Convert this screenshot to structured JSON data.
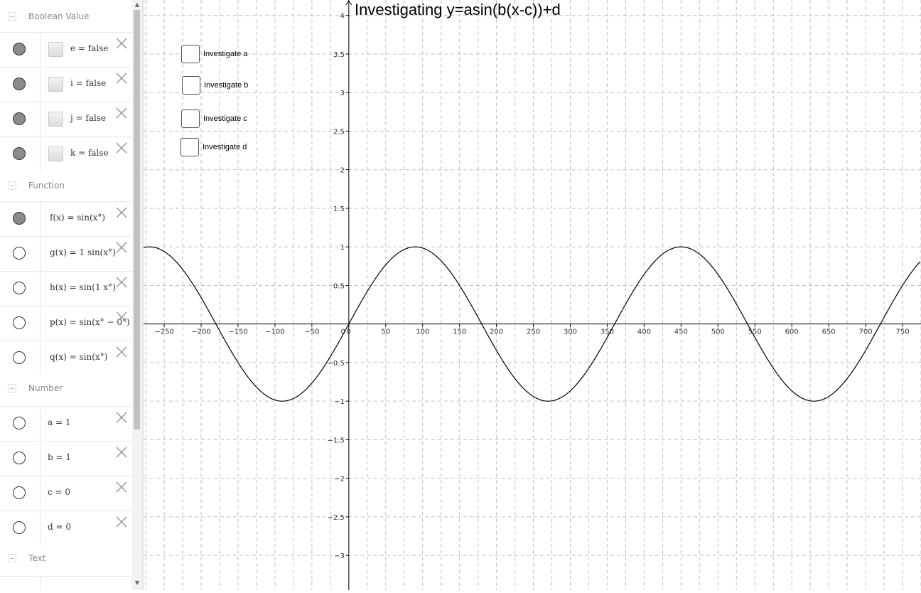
{
  "algebra": {
    "categories": [
      {
        "label": "Boolean Value"
      },
      {
        "label": "Function"
      },
      {
        "label": "Number"
      },
      {
        "label": "Text"
      }
    ],
    "boolean_rows": [
      {
        "text": "e = false",
        "visible": true
      },
      {
        "text": "i = false",
        "visible": true
      },
      {
        "text": "j = false",
        "visible": true
      },
      {
        "text": "k = false",
        "visible": true
      }
    ],
    "function_rows": [
      {
        "text": "f(x) = sin(x°)",
        "visible": true
      },
      {
        "text": "g(x) = 1 sin(x°)",
        "visible": false
      },
      {
        "text": "h(x) = sin(1 x°)",
        "visible": false
      },
      {
        "text": "p(x) = sin(x° − 0°)",
        "visible": false
      },
      {
        "text": "q(x) = sin(x°)",
        "visible": false
      }
    ],
    "number_rows": [
      {
        "text": "a = 1",
        "visible": false
      },
      {
        "text": "b = 1",
        "visible": false
      },
      {
        "text": "c = 0",
        "visible": false
      },
      {
        "text": "d = 0",
        "visible": false
      }
    ]
  },
  "graphics": {
    "title": "Investigating y=asin(b(x-c))+d",
    "checkboxes": [
      {
        "label": "Investigate a",
        "checked": false
      },
      {
        "label": "Investigate b",
        "checked": false
      },
      {
        "label": "Investigate c",
        "checked": false
      },
      {
        "label": "Investigate d",
        "checked": false
      }
    ],
    "curve_color": "#000000",
    "grid_color": "#c0c0c0"
  },
  "chart_data": {
    "type": "line",
    "title": "Investigating y=asin(b(x-c))+d",
    "function": "y = sin(x°)",
    "xlim": [
      -278,
      775
    ],
    "ylim": [
      -3.45,
      4.2
    ],
    "x_ticks": [
      -250,
      -200,
      -150,
      -100,
      -50,
      0,
      50,
      100,
      150,
      200,
      250,
      300,
      350,
      400,
      450,
      500,
      550,
      600,
      650,
      700,
      750
    ],
    "y_ticks": [
      -3,
      -2.5,
      -2,
      -1.5,
      -1,
      -0.5,
      0.5,
      1,
      1.5,
      2,
      2.5,
      3,
      3.5,
      4
    ],
    "grid": true,
    "series": [
      {
        "x": [
          -270,
          -180,
          -90,
          0,
          90,
          180,
          270,
          360,
          450,
          540,
          630,
          720
        ],
        "values": [
          1,
          0,
          -1,
          0,
          1,
          0,
          -1,
          0,
          1,
          0,
          -1,
          0
        ]
      }
    ]
  }
}
